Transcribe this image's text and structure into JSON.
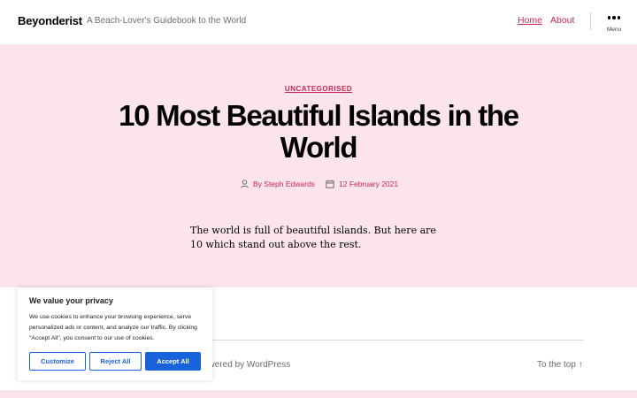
{
  "header": {
    "site_title": "Beyonderist",
    "site_description": "A Beach-Lover's Guidebook to the World",
    "nav": {
      "home": "Home",
      "about": "About"
    },
    "menu_label": "Menu",
    "menu_icon": "more-dots-icon"
  },
  "post": {
    "category": "UNCATEGORISED",
    "title": "10 Most Beautiful Islands in the World",
    "author": "By Steph Edwards",
    "author_icon": "user-icon",
    "date": "12 February 2021",
    "date_icon": "calendar-icon",
    "excerpt": "The world is full of beautiful islands. But here are 10 which stand out above the rest."
  },
  "footer": {
    "credit": "owered by WordPress",
    "to_top": "To the top ↑"
  },
  "cookie_banner": {
    "title": "We value your privacy",
    "text": "We use cookies to enhance your browsing experience, serve personalized ads or content, and analyze our traffic. By clicking \"Accept All\", you consent to our use of cookies.",
    "customize": "Customize",
    "reject": "Reject All",
    "accept": "Accept All"
  },
  "colors": {
    "accent": "#cd2653",
    "hero_background": "#fce4ec",
    "cookie_button": "#1863dc"
  }
}
